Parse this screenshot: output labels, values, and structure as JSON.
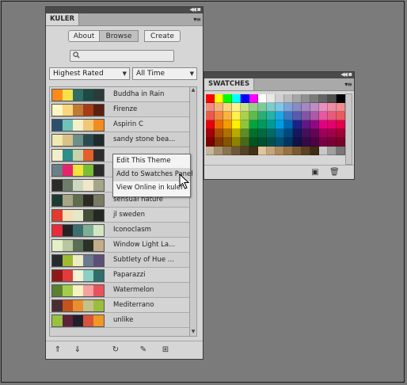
{
  "kuler": {
    "title": "KULER",
    "buttons": {
      "about": "About",
      "browse": "Browse",
      "create": "Create"
    },
    "search": {
      "value": "",
      "placeholder": ""
    },
    "sort": "Highest Rated",
    "time": "All Time",
    "themes": [
      {
        "name": "Buddha in Rain",
        "colors": [
          "#ff8a1c",
          "#f5e24a",
          "#2f6e66",
          "#1c4a44",
          "#2b3b3a"
        ]
      },
      {
        "name": "Firenze",
        "colors": [
          "#fff7c2",
          "#f9d67c",
          "#c07a33",
          "#a63b16",
          "#5a2010"
        ]
      },
      {
        "name": "Aspirin C",
        "colors": [
          "#2c4f6e",
          "#6ec2b8",
          "#f5f0c8",
          "#f1c878",
          "#f28c1e"
        ]
      },
      {
        "name": "sandy stone bea...",
        "colors": [
          "#f0e9b0",
          "#d8c287",
          "#6c8f8a",
          "#2a4a4e",
          "#1e2a2c"
        ]
      },
      {
        "name": "",
        "colors": [
          "#f2eec9",
          "#2c8f8a",
          "#c7d3a8",
          "#e55f2a",
          "#2d2d2d"
        ]
      },
      {
        "name": "",
        "colors": [
          "#6a7f86",
          "#e8236e",
          "#f3e43c",
          "#7bbe36",
          "#2b2b2b"
        ]
      },
      {
        "name": "",
        "colors": [
          "#2b2b2b",
          "#6e7d6a",
          "#ccd8bf",
          "#f0e7c8",
          "#a5a58a"
        ]
      },
      {
        "name": "sensual nature",
        "colors": [
          "#1d3a32",
          "#a8a586",
          "#5d6e4e",
          "#2a2a23",
          "#797a62"
        ]
      },
      {
        "name": "jl sweden",
        "colors": [
          "#e33a2b",
          "#f5ddb6",
          "#e6e8c9",
          "#434d3a",
          "#222922"
        ]
      },
      {
        "name": "Iconoclasm",
        "colors": [
          "#e62c3a",
          "#232326",
          "#3c6e70",
          "#7fae97",
          "#d3e6c4"
        ]
      },
      {
        "name": "Window Light La...",
        "colors": [
          "#e4f0ca",
          "#b8c79d",
          "#5b6e56",
          "#2a3228",
          "#c2ae88"
        ]
      },
      {
        "name": "Subtlety of Hue ...",
        "colors": [
          "#262a2f",
          "#9fba32",
          "#ecedc3",
          "#6b7a8f",
          "#5d4e78"
        ]
      },
      {
        "name": "Paparazzi",
        "colors": [
          "#8e1a18",
          "#e23b3b",
          "#f5f2d4",
          "#8dcfc4",
          "#2f6e6a"
        ]
      },
      {
        "name": "Watermelon",
        "colors": [
          "#5b8030",
          "#a4cb4c",
          "#f6f2c2",
          "#f7a1a1",
          "#e8535b"
        ]
      },
      {
        "name": "Mediterrano",
        "colors": [
          "#4a2c33",
          "#c2541c",
          "#eb8f2e",
          "#c4c28b",
          "#9cbe3e"
        ]
      },
      {
        "name": "unlike",
        "colors": [
          "#99c140",
          "#5c233a",
          "#1f1f2c",
          "#d9533c",
          "#ee9826"
        ]
      }
    ],
    "context_menu": [
      "Edit This Theme",
      "Add to Swatches Panel",
      "View Online in kuler"
    ]
  },
  "swatches_panel": {
    "title": "SWATCHES",
    "grid": [
      [
        "#ff0000",
        "#ffff00",
        "#00ff00",
        "#00ffff",
        "#0000ff",
        "#ff00ff",
        "#ffffff",
        "#e8e8e8",
        "#d0d0d0",
        "#bcbcbc",
        "#a6a6a6",
        "#909090",
        "#7a7a7a",
        "#646464",
        "#4e4e4e",
        "#000000"
      ],
      [
        "#f08c82",
        "#f6b27a",
        "#fbd47e",
        "#fff28a",
        "#c7e187",
        "#95d28a",
        "#7ccb9c",
        "#7cccc8",
        "#7cc6ec",
        "#7fa3d9",
        "#8a8ac6",
        "#a488c1",
        "#c08cc3",
        "#ea90bf",
        "#f08ca4",
        "#f08c8e"
      ],
      [
        "#ea5a4c",
        "#f08a3e",
        "#f9b23e",
        "#fff04a",
        "#a8d14c",
        "#5dbb4e",
        "#2aae73",
        "#22b3ac",
        "#1fa7e2",
        "#3f78c0",
        "#5a5aad",
        "#8156a6",
        "#ae58a8",
        "#e6589f",
        "#e85a7c",
        "#ea5a60"
      ],
      [
        "#e3000f",
        "#eb6a00",
        "#f39d00",
        "#ffef00",
        "#8cc63e",
        "#00a440",
        "#009a5f",
        "#009d95",
        "#009edf",
        "#0068b5",
        "#1d2088",
        "#5f1985",
        "#920783",
        "#e4007f",
        "#e5006a",
        "#e5004f"
      ],
      [
        "#a3000a",
        "#a84c00",
        "#ae7000",
        "#b8ab00",
        "#5e8c28",
        "#00702c",
        "#006a40",
        "#006c66",
        "#006c9c",
        "#00497f",
        "#15185f",
        "#43105c",
        "#660359",
        "#a0005a",
        "#a1004a",
        "#a10036"
      ],
      [
        "#7c0006",
        "#813800",
        "#855400",
        "#8e8400",
        "#466a1c",
        "#005420",
        "#005030",
        "#00514d",
        "#005176",
        "#00365f",
        "#0f1148",
        "#320b46",
        "#4e0144",
        "#7a0044",
        "#7b0038",
        "#7b0028"
      ],
      [
        "#c6b69a",
        "#a6926e",
        "#8a744e",
        "#6e5838",
        "#584226",
        "#423018",
        "#e0c49c",
        "#c8a47a",
        "#b08a5c",
        "#987242",
        "#7a5a30",
        "#5c4222",
        "#3e2c16",
        "#c8c8c8",
        "#a0a0a0",
        "#787878"
      ]
    ]
  }
}
